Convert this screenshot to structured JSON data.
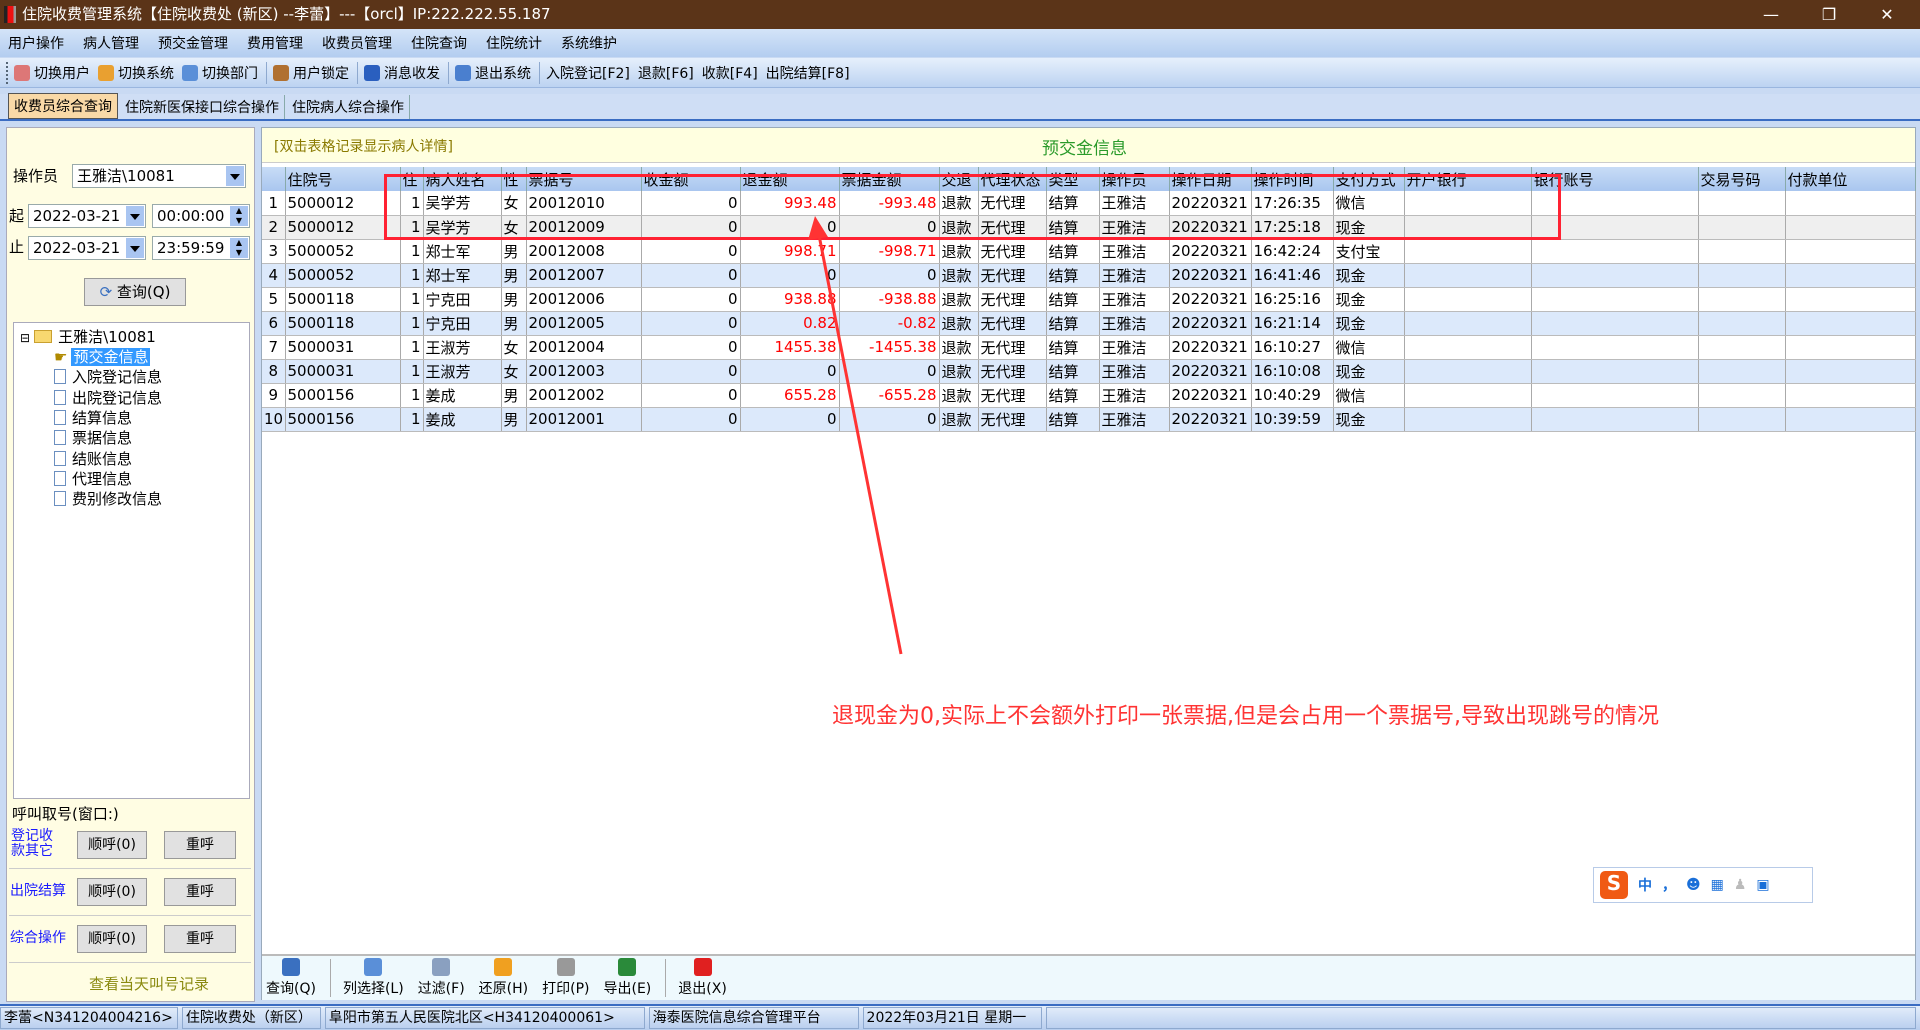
{
  "window": {
    "title": "住院收费管理系统【住院收费处 (新区) --李蕾】---【orcl】IP:222.222.55.187"
  },
  "menu": [
    "用户操作",
    "病人管理",
    "预交金管理",
    "费用管理",
    "收费员管理",
    "住院查询",
    "住院统计",
    "系统维护"
  ],
  "toolbar": [
    {
      "label": "切换用户",
      "icon": "switch-user-icon",
      "color": "#d77"
    },
    {
      "label": "切换系统",
      "icon": "switch-system-icon",
      "color": "#e9a030"
    },
    {
      "label": "切换部门",
      "icon": "switch-dept-icon",
      "color": "#5a8fd8"
    },
    {
      "label": "用户锁定",
      "icon": "user-lock-icon",
      "color": "#b07030"
    },
    {
      "label": "消息收发",
      "icon": "info-icon",
      "color": "#2a5fbf"
    },
    {
      "label": "退出系统",
      "icon": "exit-system-icon",
      "color": "#4a7fcf"
    },
    {
      "label": "入院登记[F2]"
    },
    {
      "label": "退款[F6]"
    },
    {
      "label": "收款[F4]"
    },
    {
      "label": "出院结算[F8]"
    }
  ],
  "tabs": [
    "收费员综合查询",
    "住院新医保接口综合操作",
    "住院病人综合操作"
  ],
  "left": {
    "operator_label": "操作员",
    "operator_value": "王雅洁\\10081",
    "start_label": "起",
    "start_date": "2022-03-21",
    "start_time": "00:00:00",
    "end_label": "止",
    "end_date": "2022-03-21",
    "end_time": "23:59:59",
    "query_button": "查询(Q)",
    "tree_root": "王雅洁\\10081",
    "tree_items": [
      "预交金信息",
      "入院登记信息",
      "出院登记信息",
      "结算信息",
      "票据信息",
      "结账信息",
      "代理信息",
      "费别修改信息"
    ],
    "call_title": "呼叫取号(窗口:)",
    "call_rows": [
      {
        "label": "登记收款其它",
        "next": "顺呼(0)",
        "recall": "重呼"
      },
      {
        "label": "出院结算",
        "next": "顺呼(0)",
        "recall": "重呼"
      },
      {
        "label": "综合操作",
        "next": "顺呼(0)",
        "recall": "重呼"
      }
    ],
    "call_log_link": "查看当天叫号记录"
  },
  "main": {
    "hint": "[双击表格记录显示病人详情]",
    "title": "预交金信息",
    "columns": [
      "住院号",
      "住",
      "病人姓名",
      "性",
      "票据号",
      "收金额",
      "退金额",
      "票据金额",
      "交退",
      "代理状态",
      "类型",
      "操作员",
      "操作日期",
      "操作时间",
      "支付方式",
      "开户银行",
      "银行账号",
      "交易号码",
      "付款单位"
    ],
    "rows": [
      [
        "5000012",
        "1",
        "吴学芳",
        "女",
        "20012010",
        "0",
        "993.48",
        "-993.48",
        "退款",
        "无代理",
        "结算",
        "王雅洁",
        "20220321",
        "17:26:35",
        "微信",
        "",
        "",
        "",
        ""
      ],
      [
        "5000012",
        "1",
        "吴学芳",
        "女",
        "20012009",
        "0",
        "0",
        "0",
        "退款",
        "无代理",
        "结算",
        "王雅洁",
        "20220321",
        "17:25:18",
        "现金",
        "",
        "",
        "",
        ""
      ],
      [
        "5000052",
        "1",
        "郑士军",
        "男",
        "20012008",
        "0",
        "998.71",
        "-998.71",
        "退款",
        "无代理",
        "结算",
        "王雅洁",
        "20220321",
        "16:42:24",
        "支付宝",
        "",
        "",
        "",
        ""
      ],
      [
        "5000052",
        "1",
        "郑士军",
        "男",
        "20012007",
        "0",
        "0",
        "0",
        "退款",
        "无代理",
        "结算",
        "王雅洁",
        "20220321",
        "16:41:46",
        "现金",
        "",
        "",
        "",
        ""
      ],
      [
        "5000118",
        "1",
        "宁克田",
        "男",
        "20012006",
        "0",
        "938.88",
        "-938.88",
        "退款",
        "无代理",
        "结算",
        "王雅洁",
        "20220321",
        "16:25:16",
        "现金",
        "",
        "",
        "",
        ""
      ],
      [
        "5000118",
        "1",
        "宁克田",
        "男",
        "20012005",
        "0",
        "0.82",
        "-0.82",
        "退款",
        "无代理",
        "结算",
        "王雅洁",
        "20220321",
        "16:21:14",
        "现金",
        "",
        "",
        "",
        ""
      ],
      [
        "5000031",
        "1",
        "王淑芳",
        "女",
        "20012004",
        "0",
        "1455.38",
        "-1455.38",
        "退款",
        "无代理",
        "结算",
        "王雅洁",
        "20220321",
        "16:10:27",
        "微信",
        "",
        "",
        "",
        ""
      ],
      [
        "5000031",
        "1",
        "王淑芳",
        "女",
        "20012003",
        "0",
        "0",
        "0",
        "退款",
        "无代理",
        "结算",
        "王雅洁",
        "20220321",
        "16:10:08",
        "现金",
        "",
        "",
        "",
        ""
      ],
      [
        "5000156",
        "1",
        "姜成",
        "男",
        "20012002",
        "0",
        "655.28",
        "-655.28",
        "退款",
        "无代理",
        "结算",
        "王雅洁",
        "20220321",
        "10:40:29",
        "微信",
        "",
        "",
        "",
        ""
      ],
      [
        "5000156",
        "1",
        "姜成",
        "男",
        "20012001",
        "0",
        "0",
        "0",
        "退款",
        "无代理",
        "结算",
        "王雅洁",
        "20220321",
        "10:39:59",
        "现金",
        "",
        "",
        "",
        ""
      ]
    ],
    "selected_row": 2,
    "annotation": "退现金为0,实际上不会额外打印一张票据,但是会占用一个票据号,导致出现跳号的情况",
    "ime": {
      "mode": "中",
      "punct": "，"
    },
    "bottom_buttons": [
      {
        "label": "查询(Q)",
        "icon": "refresh-icon",
        "color": "#3a70c0"
      },
      {
        "label": "列选择(L)",
        "icon": "column-select-icon",
        "color": "#5a8fd8"
      },
      {
        "label": "过滤(F)",
        "icon": "hourglass-icon",
        "color": "#8aa0c0"
      },
      {
        "label": "还原(H)",
        "icon": "restore-arrow-icon",
        "color": "#f0a020"
      },
      {
        "label": "打印(P)",
        "icon": "printer-icon",
        "color": "#999"
      },
      {
        "label": "导出(E)",
        "icon": "excel-export-icon",
        "color": "#2a8a3a"
      },
      {
        "label": "退出(X)",
        "icon": "power-icon",
        "color": "#e02020"
      }
    ]
  },
  "status": [
    "李蕾<N341204004216>",
    "住院收费处（新区）",
    "阜阳市第五人民医院北区<H34120400061>",
    "海泰医院信息综合管理平台",
    "2022年03月21日 星期一"
  ]
}
